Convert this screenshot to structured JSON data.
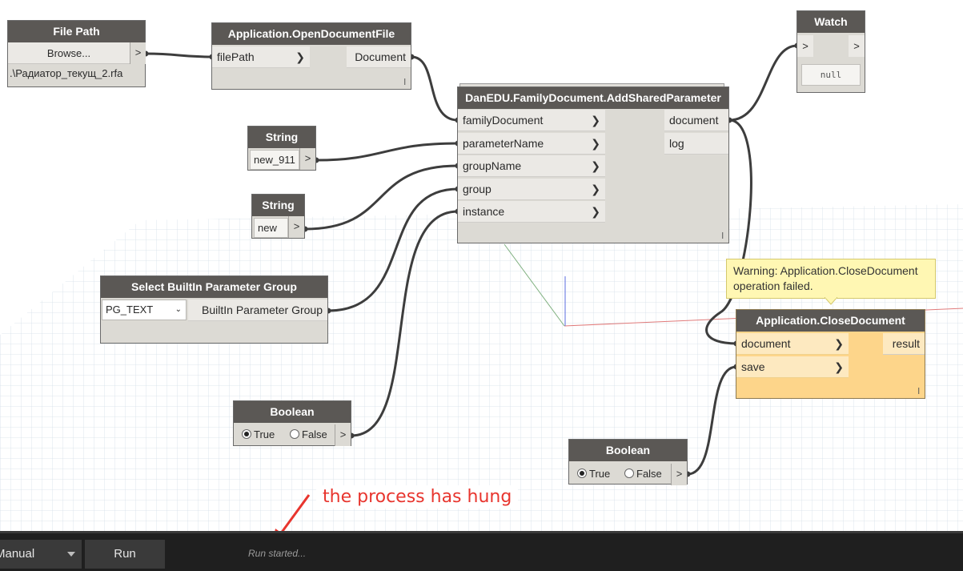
{
  "nodes": {
    "file_path": {
      "title": "File Path",
      "browse_label": "Browse...",
      "arrow": ">",
      "value": ".\\Радиатор_текущ_2.rfa"
    },
    "open_doc": {
      "title": "Application.OpenDocumentFile",
      "input": "filePath",
      "output": "Document",
      "mark": "l"
    },
    "add_param": {
      "title": "DanEDU.FamilyDocument.AddSharedParameter",
      "inputs": [
        "familyDocument",
        "parameterName",
        "groupName",
        "group",
        "instance"
      ],
      "outputs": [
        "document",
        "log"
      ],
      "mark": "l"
    },
    "watch": {
      "title": "Watch",
      "in_arrow": ">",
      "out_arrow": ">",
      "value": "null"
    },
    "string1": {
      "title": "String",
      "value": "new_911",
      "arrow": ">"
    },
    "string2": {
      "title": "String",
      "value": "new",
      "arrow": ">"
    },
    "param_group": {
      "title": "Select BuiltIn Parameter Group",
      "selected": "PG_TEXT",
      "output": "BuiltIn Parameter Group"
    },
    "boolean1": {
      "title": "Boolean",
      "true_label": "True",
      "false_label": "False",
      "arrow": ">"
    },
    "boolean2": {
      "title": "Boolean",
      "true_label": "True",
      "false_label": "False",
      "arrow": ">"
    },
    "close_doc": {
      "title": "Application.CloseDocument",
      "inputs": [
        "document",
        "save"
      ],
      "output": "result",
      "mark": "l"
    }
  },
  "warning": {
    "text": "Warning: Application.CloseDocument operation failed."
  },
  "annotation": {
    "text": "the process has hung"
  },
  "footer": {
    "run_mode": "Manual",
    "run_button": "Run",
    "status": "Run started..."
  },
  "colors": {
    "wire": "#3d3d3d",
    "node_header": "#5b5855",
    "warning_node": "#fdd58a",
    "annotation_red": "#e8352e"
  }
}
